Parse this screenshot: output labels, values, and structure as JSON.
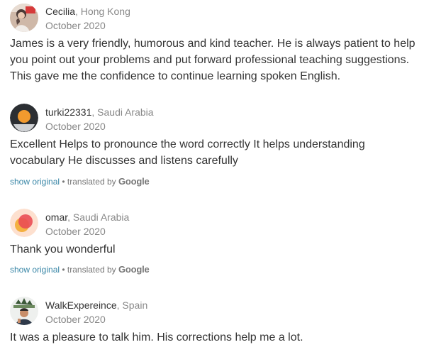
{
  "reviews": [
    {
      "name": "Cecilia",
      "country": ", Hong Kong",
      "date": "October 2020",
      "text": "James is a very friendly, humorous and kind teacher. He is always patient to help you point out your problems and put forward professional teaching suggestions. This gave me the confidence to continue learning spoken English.",
      "avatar_icon": "user-photo-avatar"
    },
    {
      "name": "turki22331",
      "country": ", Saudi Arabia",
      "date": "October 2020",
      "text": "Excellent Helps to pronounce the word correctly It helps understanding vocabulary He discusses and listens carefully",
      "avatar_icon": "orange-circle-avatar",
      "show_original": "show original",
      "translated_by": " • translated by ",
      "google": "Google"
    },
    {
      "name": "omar",
      "country": ", Saudi Arabia",
      "date": "October 2020",
      "text": "Thank you wonderful",
      "avatar_icon": "pink-circle-avatar",
      "show_original": "show original",
      "translated_by": " • translated by ",
      "google": "Google"
    },
    {
      "name": "WalkExpereince",
      "country": ", Spain",
      "date": "October 2020",
      "text": "It was a pleasure to talk him. His corrections help me a lot.",
      "avatar_icon": "user-photo-avatar"
    }
  ],
  "colors": {
    "text": "#333333",
    "muted": "#888888",
    "link": "#3a87a7"
  }
}
